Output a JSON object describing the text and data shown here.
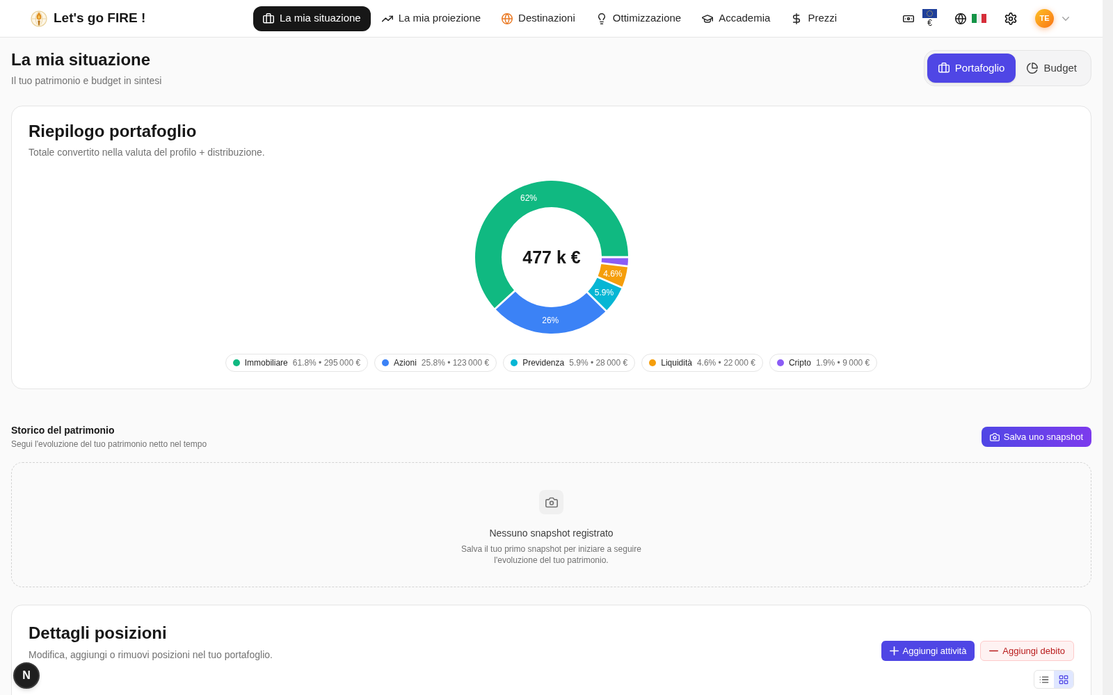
{
  "header": {
    "brand": "Let's go FIRE !",
    "nav": [
      {
        "label": "La mia situazione",
        "selected": true
      },
      {
        "label": "La mia proiezione",
        "selected": false
      },
      {
        "label": "Destinazioni",
        "selected": false
      },
      {
        "label": "Ottimizzazione",
        "selected": false
      },
      {
        "label": "Accademia",
        "selected": false
      },
      {
        "label": "Prezzi",
        "selected": false
      }
    ],
    "currency": "€",
    "avatar_initials": "TE"
  },
  "page": {
    "title": "La mia situazione",
    "subtitle": "Il tuo patrimonio e budget in sintesi"
  },
  "view_tabs": [
    {
      "label": "Portafoglio",
      "selected": true
    },
    {
      "label": "Budget",
      "selected": false
    }
  ],
  "portfolio_summary": {
    "title": "Riepilogo portafoglio",
    "subtitle": "Totale convertito nella valuta del profilo + distribuzione.",
    "total": "477 k €",
    "chart_data": {
      "type": "donut",
      "categories": [
        "Immobiliare",
        "Azioni",
        "Previdenza",
        "Liquidità",
        "Cripto"
      ],
      "series": [
        {
          "values": [
            61.8,
            25.8,
            5.9,
            4.6,
            1.9
          ]
        }
      ],
      "value_labels": [
        "62%",
        "26%",
        "5.9%",
        "4.6%"
      ]
    },
    "legend": [
      {
        "value": "61.8% • 295 000 €",
        "color": "#10b981"
      },
      {
        "value": "25.8% • 123 000 €",
        "color": "#3b82f6"
      },
      {
        "value": "5.9% • 28 000 €",
        "color": "#06b6d4"
      },
      {
        "value": "4.6% • 22 000 €",
        "color": "#f59e0b"
      },
      {
        "value": "1.9% • 9 000 €",
        "color": "#8b5cf6"
      }
    ]
  },
  "history": {
    "title": "Storico del patrimonio",
    "subtitle": "Segui l'evoluzione del tuo patrimonio netto nel tempo",
    "button": "Salva uno snapshot",
    "empty_state": {
      "title": "Nessuno snapshot registrato",
      "text": "Salva il tuo primo snapshot per iniziare a seguire l'evoluzione del tuo patrimonio."
    }
  },
  "positions": {
    "title": "Dettagli posizioni",
    "subtitle": "Modifica, aggiungi o rimuovi posizioni nel tuo portafoglio.",
    "actions": [
      {
        "label": "Aggiungi attività",
        "kind": "primary"
      },
      {
        "label": "Aggiungi debito",
        "kind": "danger"
      }
    ],
    "view_modes": [
      {
        "kind": "list",
        "selected": false
      },
      {
        "kind": "grid",
        "selected": true
      }
    ]
  },
  "dev_badge": "N"
}
